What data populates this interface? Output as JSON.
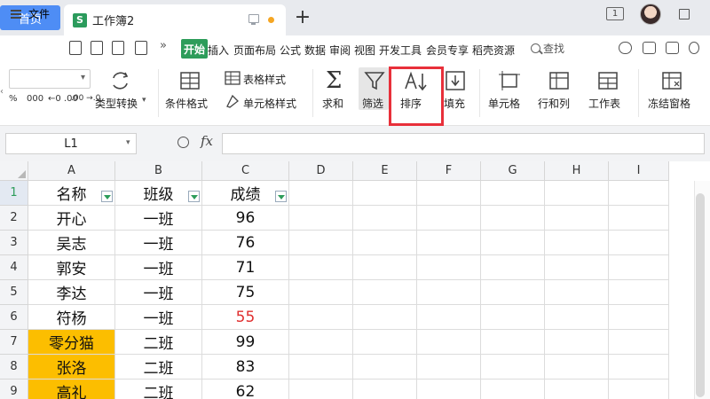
{
  "titlebar": {
    "home_tab": "首页",
    "doc_tab": "工作簿2",
    "doc_icon": "S",
    "new_tab": "+",
    "window_count": "1"
  },
  "menubar": {
    "file": "文件",
    "start": "开始",
    "items": [
      "插入",
      "页面布局",
      "公式",
      "数据",
      "审阅",
      "视图",
      "开发工具",
      "会员专享",
      "稻壳资源"
    ],
    "search": "查找"
  },
  "ribbon": {
    "number_formats": [
      "%",
      "000",
      "←0 .00",
      ".00 →.0"
    ],
    "type_convert": "类型转换",
    "conditional_format": "条件格式",
    "table_style": "表格样式",
    "cell_style": "单元格样式",
    "sum": "求和",
    "filter": "筛选",
    "sort": "排序",
    "fill": "填充",
    "cell": "单元格",
    "row_col": "行和列",
    "worksheet": "工作表",
    "freeze": "冻结窗格"
  },
  "formula": {
    "namebox": "L1",
    "fx": "fx",
    "value": ""
  },
  "grid": {
    "columns": [
      "A",
      "B",
      "C",
      "D",
      "E",
      "F",
      "G",
      "H",
      "I"
    ],
    "rows": [
      "1",
      "2",
      "3",
      "4",
      "5",
      "6",
      "7",
      "8",
      "9"
    ],
    "header": [
      "名称",
      "班级",
      "成绩"
    ],
    "data": [
      [
        "开心",
        "一班",
        "96"
      ],
      [
        "吴志",
        "一班",
        "76"
      ],
      [
        "郭安",
        "一班",
        "71"
      ],
      [
        "李达",
        "一班",
        "75"
      ],
      [
        "符杨",
        "一班",
        "55"
      ],
      [
        "零分猫",
        "二班",
        "99"
      ],
      [
        "张洛",
        "二班",
        "83"
      ],
      [
        "高礼",
        "二班",
        "62"
      ]
    ]
  },
  "colors": {
    "accent": "#2d9c5a",
    "home_tab": "#4e8df5",
    "highlight_cell": "#fcbe00",
    "fail_score": "#e03030",
    "callout": "#e8303a"
  }
}
